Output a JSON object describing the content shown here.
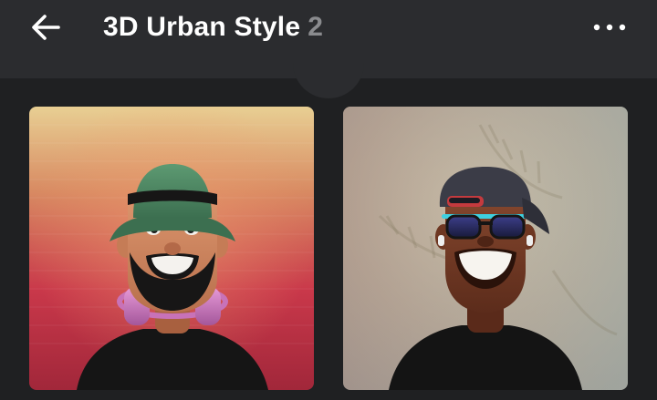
{
  "header": {
    "title": "3D Urban Style",
    "count": "2",
    "back_icon": "arrow-left-icon",
    "more_icon": "more-horizontal-icon"
  },
  "colors": {
    "header_bg": "#2b2c2f",
    "page_bg": "#1f2022",
    "count_text": "#8a8b8e"
  },
  "avatars": [
    {
      "description_icon": "avatar-bucket-hat-headphones"
    },
    {
      "description_icon": "avatar-backwards-cap-sunglasses"
    }
  ]
}
